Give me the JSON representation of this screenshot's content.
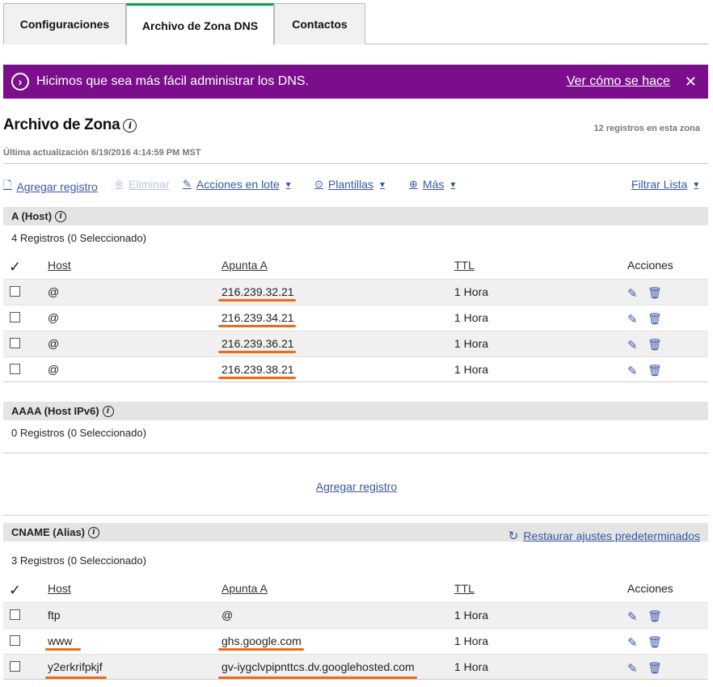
{
  "tabs": [
    {
      "label": "Configuraciones"
    },
    {
      "label": "Archivo de Zona DNS"
    },
    {
      "label": "Contactos"
    }
  ],
  "banner": {
    "message": "Hicimos que sea más fácil administrar los DNS.",
    "link": "Ver cómo se hace",
    "close": "✕",
    "color": "#7b0f8b"
  },
  "zone": {
    "title": "Archivo de Zona",
    "record_count": "12 registros en esta zona",
    "last_updated": "Última actualización 6/19/2016 4:14:59 PM MST"
  },
  "toolbar": {
    "add": "Agregar registro",
    "delete": "Eliminar",
    "bulk": "Acciones en lote",
    "templates": "Plantillas",
    "more": "Más",
    "filter": "Filtrar Lista"
  },
  "columns": {
    "host": "Host",
    "points_to": "Apunta A",
    "ttl": "TTL",
    "actions": "Acciones"
  },
  "sections": {
    "a": {
      "title": "A (Host)",
      "count": "4 Registros (0 Seleccionado)",
      "rows": [
        {
          "host": "@",
          "points_to": "216.239.32.21",
          "ttl": "1 Hora"
        },
        {
          "host": "@",
          "points_to": "216.239.34.21",
          "ttl": "1 Hora"
        },
        {
          "host": "@",
          "points_to": "216.239.36.21",
          "ttl": "1 Hora"
        },
        {
          "host": "@",
          "points_to": "216.239.38.21",
          "ttl": "1 Hora"
        }
      ]
    },
    "aaaa": {
      "title": "AAAA (Host IPv6)",
      "count": "0 Registros (0 Seleccionado)",
      "add": "Agregar registro"
    },
    "cname": {
      "title": "CNAME (Alias)",
      "restore": "Restaurar ajustes predeterminados",
      "count": "3 Registros (0 Seleccionado)",
      "rows": [
        {
          "host": "ftp",
          "points_to": "@",
          "ttl": "1 Hora"
        },
        {
          "host": "www",
          "points_to": "ghs.google.com",
          "ttl": "1 Hora"
        },
        {
          "host": "y2erkrifpkjf",
          "points_to": "gv-iygclvpipnttcs.dv.googlehosted.com",
          "ttl": "1 Hora"
        }
      ]
    }
  },
  "colors": {
    "accent_green": "#00a63f",
    "link_blue": "#3a57a8",
    "highlight_orange": "#f06a14"
  }
}
